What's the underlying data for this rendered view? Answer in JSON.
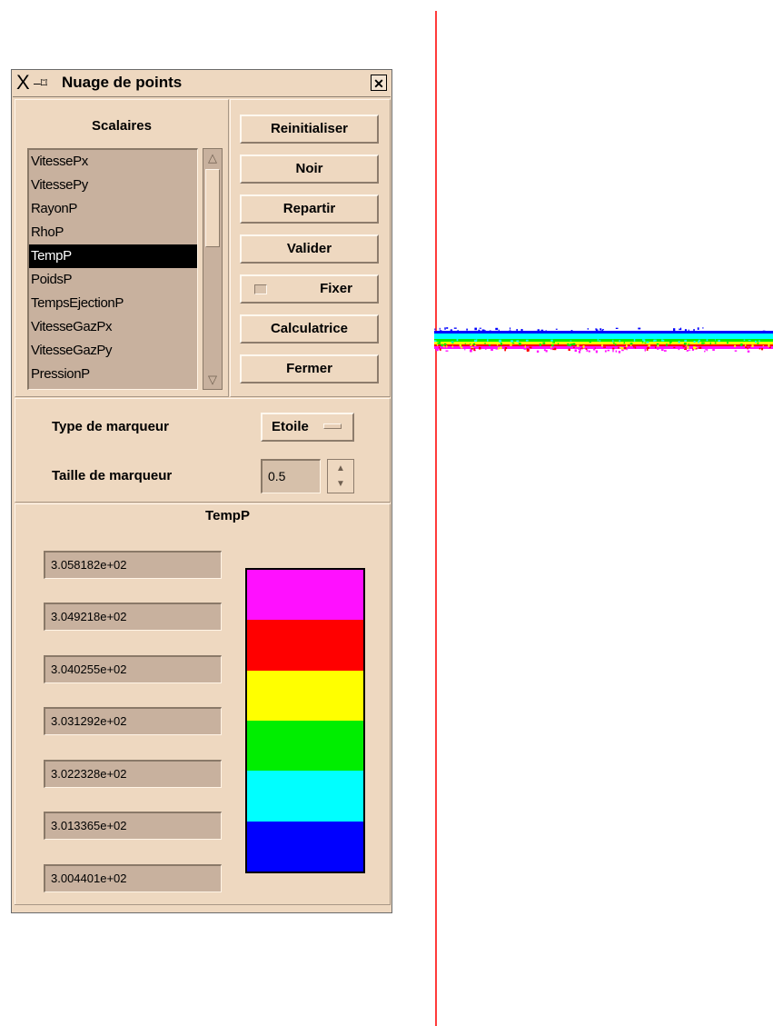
{
  "window": {
    "title": "Nuage de points",
    "title_x_glyph": "X",
    "title_pin_glyph": "–⌑",
    "close_glyph": "✕"
  },
  "scalars": {
    "title": "Scalaires",
    "items": [
      "VitesseGazPx",
      "VitesseGazPy",
      "PressionP"
    ],
    "items_top": [
      "VitessePx",
      "VitessePy",
      "RayonP",
      "RhoP",
      "TempP",
      "PoidsP",
      "TempsEjectionP"
    ],
    "selected": "TempP"
  },
  "buttons": {
    "reinit": "Reinitialiser",
    "noir": "Noir",
    "repartir": "Repartir",
    "valider": "Valider",
    "fixer": "Fixer",
    "calculatrice": "Calculatrice",
    "fermer": "Fermer"
  },
  "marker": {
    "type_label": "Type de marqueur",
    "type_value": "Etoile",
    "size_label": "Taille de marqueur",
    "size_value": "0.5"
  },
  "legend": {
    "title": "TempP",
    "values": [
      "3.058182e+02",
      "3.049218e+02",
      "3.040255e+02",
      "3.031292e+02",
      "3.022328e+02",
      "3.013365e+02",
      "3.004401e+02"
    ],
    "colors": [
      "#ff10ff",
      "#ff0000",
      "#ffff00",
      "#00ee00",
      "#00ffff",
      "#0000ff"
    ]
  },
  "plot": {
    "axis_color": "#ff3b3b"
  }
}
